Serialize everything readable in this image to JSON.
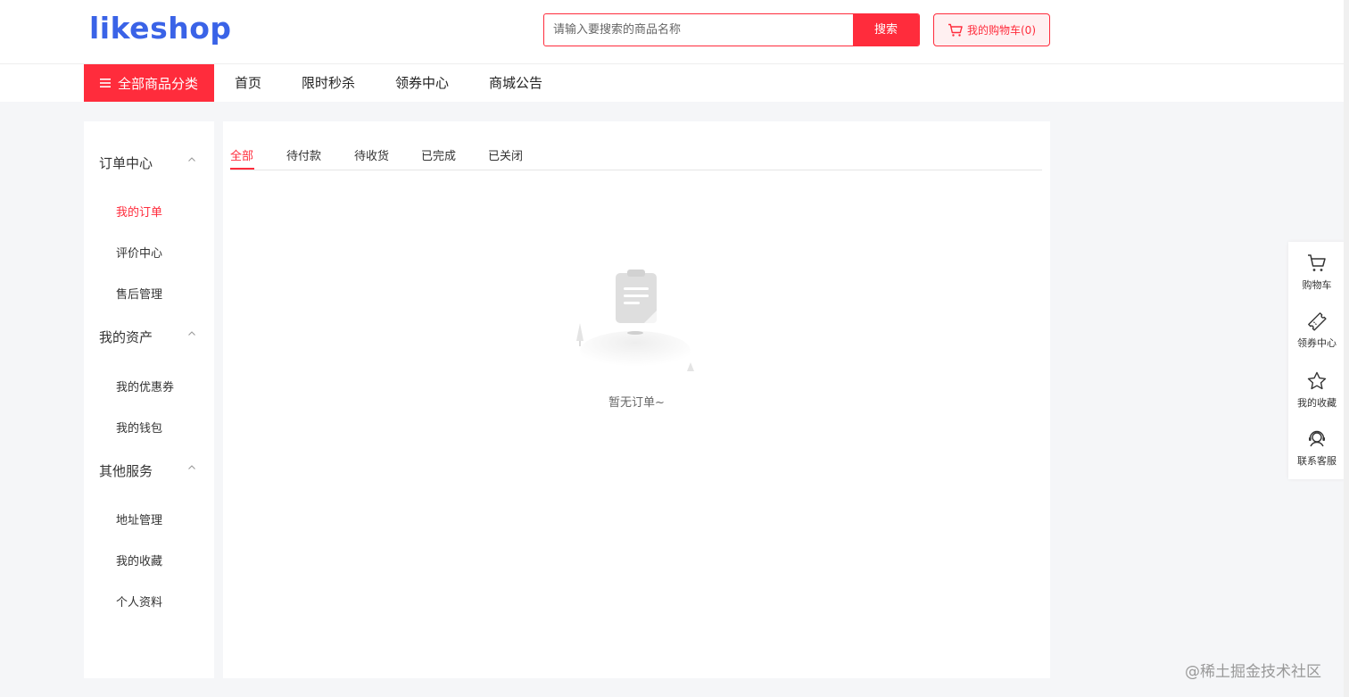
{
  "header": {
    "logo": "likeshop",
    "search_placeholder": "请输入要搜索的商品名称",
    "search_button": "搜索",
    "cart_label": "我的购物车(0)"
  },
  "nav": {
    "category_label": "全部商品分类",
    "items": [
      "首页",
      "限时秒杀",
      "领券中心",
      "商城公告"
    ]
  },
  "sidebar": {
    "groups": [
      {
        "title": "订单中心",
        "items": [
          "我的订单",
          "评价中心",
          "售后管理"
        ]
      },
      {
        "title": "我的资产",
        "items": [
          "我的优惠券",
          "我的钱包"
        ]
      },
      {
        "title": "其他服务",
        "items": [
          "地址管理",
          "我的收藏",
          "个人资料"
        ]
      }
    ],
    "active_item": "我的订单"
  },
  "main": {
    "tabs": [
      "全部",
      "待付款",
      "待收货",
      "已完成",
      "已关闭"
    ],
    "active_tab": "全部",
    "empty_text": "暂无订单~"
  },
  "float_bar": {
    "items": [
      {
        "label": "购物车",
        "icon": "cart-icon"
      },
      {
        "label": "领券中心",
        "icon": "ticket-icon"
      },
      {
        "label": "我的收藏",
        "icon": "star-icon"
      },
      {
        "label": "联系客服",
        "icon": "headset-icon"
      }
    ]
  },
  "watermark": "@稀土掘金技术社区",
  "colors": {
    "accent": "#ff2c3c",
    "brand": "#3a63e7",
    "background": "#f5f6f8"
  }
}
